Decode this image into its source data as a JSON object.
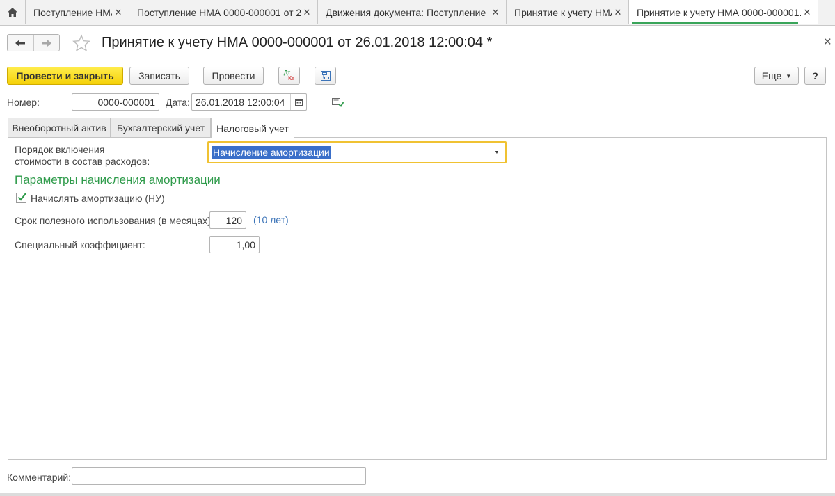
{
  "tabs": [
    {
      "label": "Поступление НМА",
      "active": false
    },
    {
      "label": "Поступление НМА 0000-000001 от 2...",
      "active": false
    },
    {
      "label": "Движения документа: Поступление ...",
      "active": false
    },
    {
      "label": "Принятие к учету НМА",
      "active": false
    },
    {
      "label": "Принятие к учету НМА 0000-000001...",
      "active": true
    }
  ],
  "header": {
    "title": "Принятие к учету НМА 0000-000001 от 26.01.2018 12:00:04 *"
  },
  "toolbar": {
    "post_and_close": "Провести и закрыть",
    "save": "Записать",
    "post": "Провести",
    "dt_kt_top": "Дт",
    "dt_kt_bottom": "Кт",
    "more": "Еще",
    "help": "?"
  },
  "fields": {
    "number_label": "Номер:",
    "number_value": "0000-000001",
    "date_label": "Дата:",
    "date_value": "26.01.2018 12:00:04",
    "comment_label": "Комментарий:",
    "comment_value": ""
  },
  "form_tabs": [
    {
      "label": "Внеоборотный актив",
      "active": false
    },
    {
      "label": "Бухгалтерский учет",
      "active": false
    },
    {
      "label": "Налоговый учет",
      "active": true
    }
  ],
  "tax": {
    "expense_order_label_line1": "Порядок включения",
    "expense_order_label_line2": "стоимости в состав расходов:",
    "expense_order_value": "Начисление амортизации",
    "params_title": "Параметры начисления амортизации",
    "accrue_label": "Начислять амортизацию (НУ)",
    "accrue_checked": true,
    "useful_life_label": "Срок полезного использования (в месяцах):",
    "useful_life_value": "120",
    "useful_life_years": "(10 лет)",
    "coef_label": "Специальный коэффициент:",
    "coef_value": "1,00"
  },
  "colors": {
    "accent_green": "#2f9b4b",
    "primary_yellow": "#f5d109",
    "link_blue": "#3c74b8",
    "selection_blue": "#3a6fc9"
  }
}
